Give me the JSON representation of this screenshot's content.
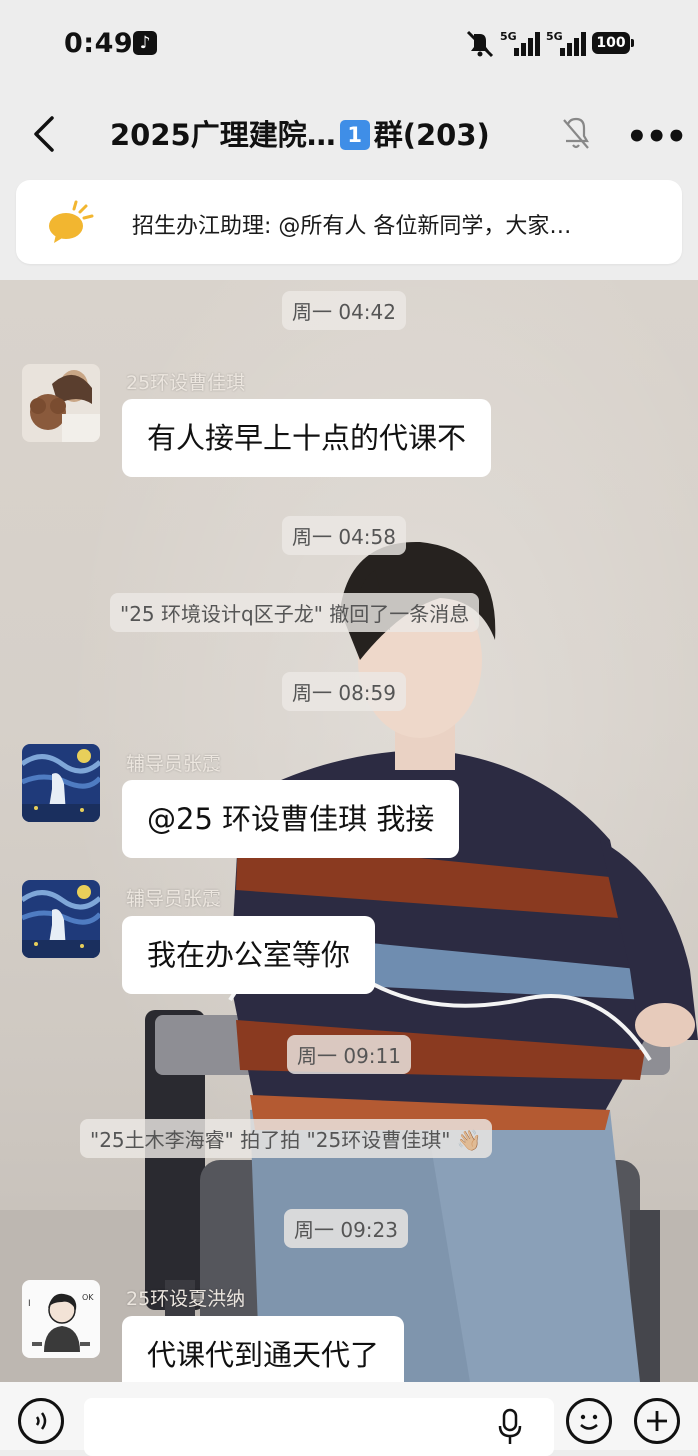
{
  "status_bar": {
    "time": "0:49",
    "signal_1": "5G",
    "signal_2": "5G",
    "battery": "100"
  },
  "header": {
    "title_part1": "2025广理建院…",
    "title_badge": "1",
    "title_part2": "群(203)",
    "icons": [
      "back-icon",
      "mute-bell-icon",
      "more-icon"
    ]
  },
  "announcement": {
    "text": "招生办江助理: @所有人  各位新同学，大家…",
    "icon": "announcement-icon"
  },
  "messages": [
    {
      "type": "time",
      "text": "周一 04:42"
    },
    {
      "type": "msg",
      "sender": "25环设曹佳琪",
      "text": "有人接早上十点的代课不",
      "avatar": "avatar-dog-photo"
    },
    {
      "type": "time",
      "text": "周一 04:58"
    },
    {
      "type": "system",
      "text": "\"25 环境设计q区子龙\" 撤回了一条消息"
    },
    {
      "type": "time",
      "text": "周一 08:59"
    },
    {
      "type": "msg",
      "sender": "辅导员张震",
      "text": "@25 环设曹佳琪  我接",
      "avatar": "avatar-starry-night"
    },
    {
      "type": "msg",
      "sender": "辅导员张震",
      "text": "我在办公室等你",
      "avatar": "avatar-starry-night"
    },
    {
      "type": "time",
      "text": "周一 09:11"
    },
    {
      "type": "system",
      "text": "\"25土木李海睿\" 拍了拍 \"25环设曹佳琪\" 👋🏼"
    },
    {
      "type": "time",
      "text": "周一 09:23"
    },
    {
      "type": "msg",
      "sender": "25环设夏洪纳",
      "text": "代课代到通天代了",
      "avatar": "avatar-cartoon"
    }
  ],
  "input_bar": {
    "icons": [
      "voice-icon",
      "mic-icon",
      "emoji-icon",
      "plus-icon"
    ]
  },
  "colors": {
    "bubble": "#ffffff",
    "page_bg": "#ededed",
    "badge": "#3f8ee7"
  }
}
